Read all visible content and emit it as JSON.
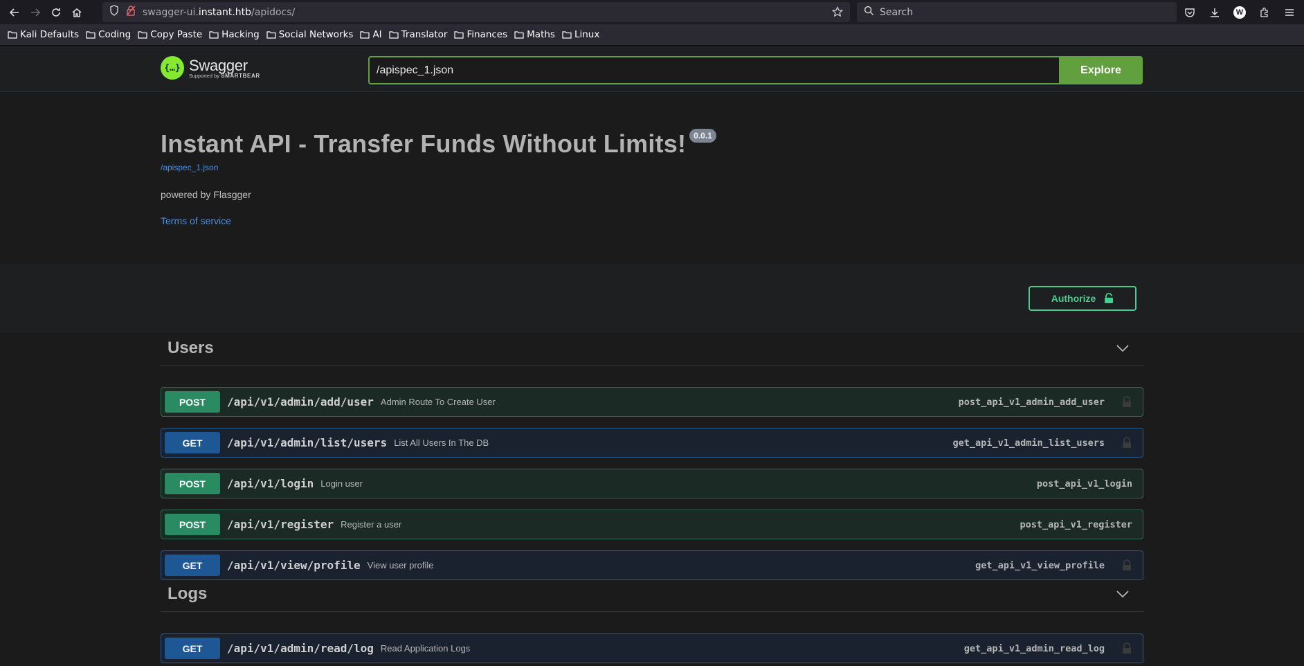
{
  "browser": {
    "url_prefix": "swagger-ui.",
    "url_host": "instant.htb",
    "url_path": "/apidocs/",
    "search_placeholder": "Search",
    "avatar_letter": "W"
  },
  "bookmarks": [
    "Kali Defaults",
    "Coding",
    "Copy Paste",
    "Hacking",
    "Social Networks",
    "AI",
    "Translator",
    "Finances",
    "Maths",
    "Linux"
  ],
  "swagger": {
    "logo_name": "Swagger",
    "logo_sub_prefix": "Supported by",
    "logo_sub_brand": "SMARTBEAR",
    "spec_input_value": "/apispec_1.json",
    "explore_label": "Explore"
  },
  "info": {
    "title": "Instant API - Transfer Funds Without Limits!",
    "version": "0.0.1",
    "spec_link": "/apispec_1.json",
    "powered_by": "powered by Flasgger",
    "terms": "Terms of service"
  },
  "authorize_label": "Authorize",
  "tags": [
    {
      "name": "Users"
    },
    {
      "name": "Logs"
    }
  ],
  "operations": [
    {
      "method": "POST",
      "path": "/api/v1/admin/add/user",
      "summary": "Admin Route To Create User",
      "op_id": "post_api_v1_admin_add_user"
    },
    {
      "method": "GET",
      "path": "/api/v1/admin/list/users",
      "summary": "List All Users In The DB",
      "op_id": "get_api_v1_admin_list_users"
    },
    {
      "method": "POST",
      "path": "/api/v1/login",
      "summary": "Login user",
      "op_id": "post_api_v1_login"
    },
    {
      "method": "POST",
      "path": "/api/v1/register",
      "summary": "Register a user",
      "op_id": "post_api_v1_register"
    },
    {
      "method": "GET",
      "path": "/api/v1/view/profile",
      "summary": "View user profile",
      "op_id": "get_api_v1_view_profile"
    },
    {
      "method": "GET",
      "path": "/api/v1/admin/read/log",
      "summary": "Read Application Logs",
      "op_id": "get_api_v1_admin_read_log"
    }
  ]
}
